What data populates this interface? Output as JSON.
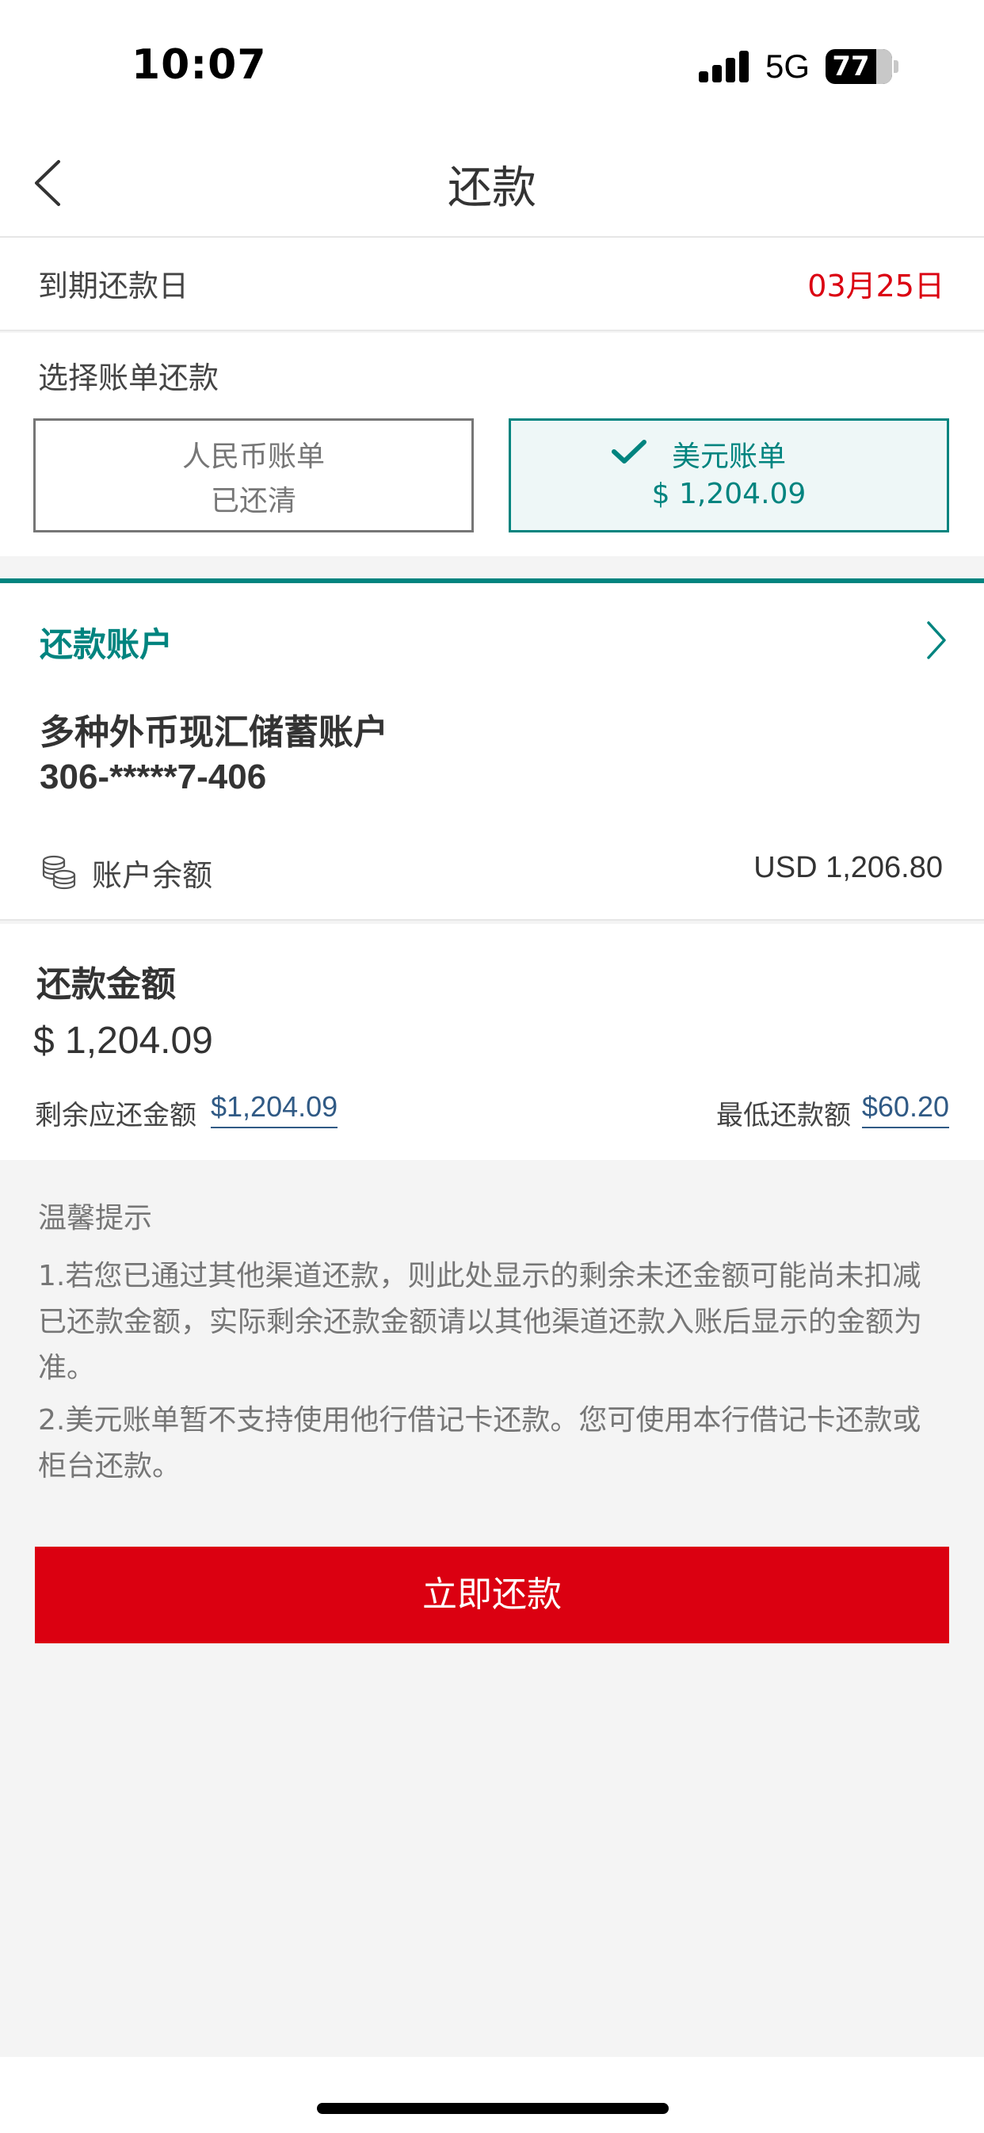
{
  "status_bar": {
    "time": "10:07",
    "network": "5G",
    "battery_level": "77"
  },
  "nav": {
    "title": "还款"
  },
  "due_date": {
    "label": "到期还款日",
    "value": "03月25日",
    "value_color": "#db0011"
  },
  "bill_select": {
    "label": "选择账单还款",
    "options": [
      {
        "title": "人民币账单",
        "subtitle": "已还清",
        "selected": false
      },
      {
        "title": "美元账单",
        "subtitle": "$ 1,204.09",
        "selected": true
      }
    ]
  },
  "account": {
    "header": "还款账户",
    "name": "多种外币现汇储蓄账户",
    "number": "306-*****7-406",
    "balance_label": "账户余额",
    "balance_value": "USD 1,206.80",
    "accent_color": "#00847f"
  },
  "amount": {
    "header": "还款金额",
    "value": "$ 1,204.09",
    "remaining_label": "剩余应还金额",
    "remaining_value": "$1,204.09",
    "minimum_label": "最低还款额",
    "minimum_value": "$60.20"
  },
  "tips": {
    "title": "温馨提示",
    "items": [
      "1.若您已通过其他渠道还款，则此处显示的剩余未还金额可能尚未扣减已还款金额，实际剩余还款金额请以其他渠道还款入账后显示的金额为准。",
      "2.美元账单暂不支持使用他行借记卡还款。您可使用本行借记卡还款或柜台还款。"
    ]
  },
  "pay_button": {
    "label": "立即还款",
    "color": "#db0011"
  },
  "icons": {
    "back": "chevron-left-icon",
    "check": "check-icon",
    "account_arrow": "chevron-right-icon",
    "balance": "coins-icon"
  }
}
